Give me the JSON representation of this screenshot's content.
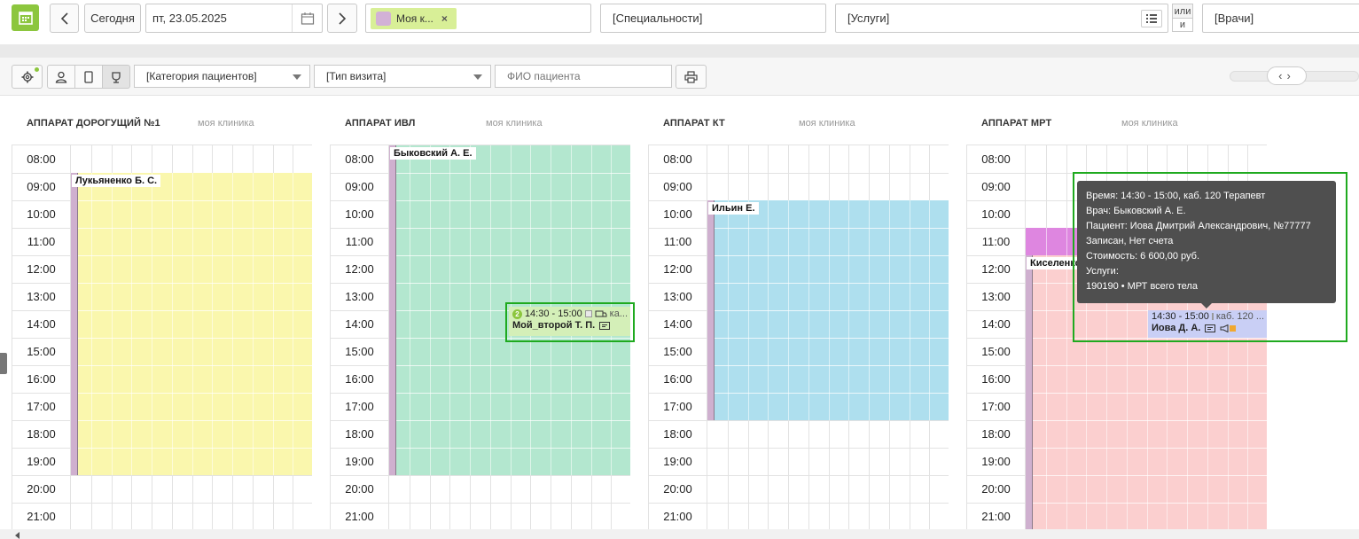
{
  "toolbar": {
    "today": "Сегодня",
    "date": "пт, 23.05.2025",
    "tag": "Моя к...",
    "tag_close": "×",
    "specialties": "[Специальности]",
    "services": "[Услуги]",
    "logic_or": "или",
    "logic_and": "и",
    "doctors": "[Врачи]"
  },
  "filters": {
    "patient_category": "[Категория пациентов]",
    "visit_type": "[Тип визита]",
    "patient_name_placeholder": "ФИО пациента"
  },
  "times": [
    "08:00",
    "09:00",
    "10:00",
    "11:00",
    "12:00",
    "13:00",
    "14:00",
    "15:00",
    "16:00",
    "17:00",
    "18:00",
    "19:00",
    "20:00",
    "21:00"
  ],
  "columns": [
    {
      "title": "АППАРАТ ДОРОГУЩИЙ №1",
      "clinic": "моя клиника",
      "doctor": "Лукьяненко Б. С."
    },
    {
      "title": "АППАРАТ ИВЛ",
      "clinic": "моя клиника",
      "doctor": "Быковский А. Е."
    },
    {
      "title": "АППАРАТ КТ",
      "clinic": "моя клиника",
      "doctor": "Ильин Е."
    },
    {
      "title": "АППАРАТ МРТ",
      "clinic": "моя клиника",
      "doctor": "Киселенко"
    }
  ],
  "appointments": {
    "ivl": {
      "badge": "2",
      "time": "14:30 - 15:00",
      "room": "ка...",
      "patient": "Мой_второй Т. П."
    },
    "mrt": {
      "time": "14:30 - 15:00",
      "room": "каб. 120 ...",
      "patient": "Иова Д. А."
    }
  },
  "tooltip": {
    "line1": "Время: 14:30 - 15:00, каб. 120 Терапевт",
    "line2": "Врач: Быковский А. Е.",
    "line3": "Пациент: Иова Дмитрий Александрович, №77777",
    "line4": "Записан, Нет счета",
    "line5": "Стоимость: 6 600,00 руб.",
    "line6": "Услуги:",
    "line7": "190190 • МРТ всего тела"
  },
  "colors": {
    "accent": "#8cc63e",
    "yellow": "#faf7ad",
    "green": "#b3e7cf",
    "blue": "#aedfee",
    "pink": "#fbcfcf",
    "magenta": "#de86e0",
    "highlight": "#1faa1f"
  },
  "icons": [
    "calendar-app-icon",
    "chevron-left-icon",
    "chevron-right-icon",
    "calendar-icon",
    "list-icon",
    "gear-icon",
    "person-icon",
    "phone-icon",
    "cup-icon",
    "printer-icon",
    "card-icon",
    "ambulance-icon",
    "megaphone-icon"
  ]
}
